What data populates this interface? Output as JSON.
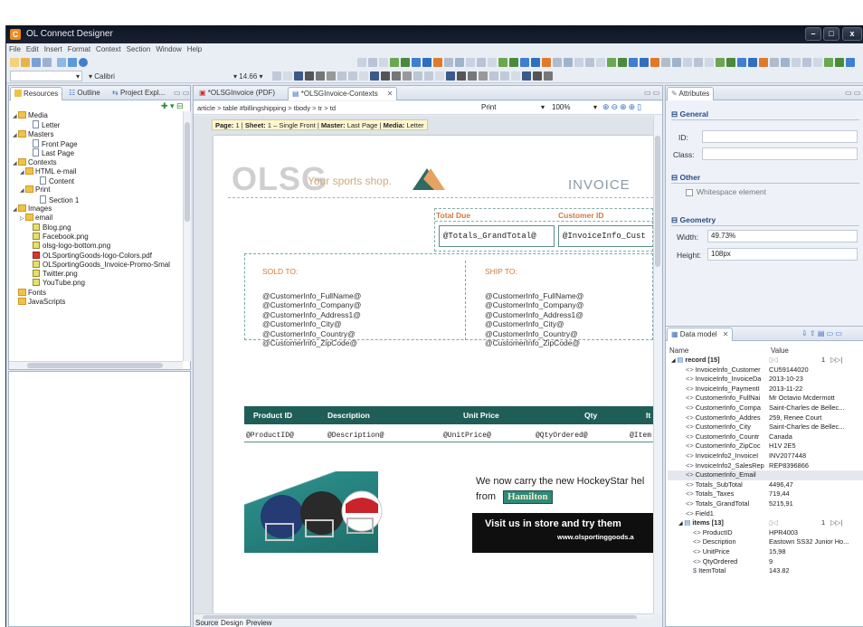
{
  "window": {
    "title": "OL Connect Designer",
    "icon": "C"
  },
  "menu": [
    "File",
    "Edit",
    "Insert",
    "Format",
    "Context",
    "Section",
    "Window",
    "Help"
  ],
  "font": {
    "name": "Calibri",
    "size": "14.66"
  },
  "left_tabs": [
    "Resources",
    "Outline",
    "Project Expl..."
  ],
  "tree": [
    {
      "label": "Media",
      "indent": 0,
      "icon": "folder",
      "tw": "◢"
    },
    {
      "label": "Letter",
      "indent": 2,
      "icon": "file",
      "tw": ""
    },
    {
      "label": "Masters",
      "indent": 0,
      "icon": "folder",
      "tw": "◢"
    },
    {
      "label": "Front Page",
      "indent": 2,
      "icon": "file",
      "tw": ""
    },
    {
      "label": "Last Page",
      "indent": 2,
      "icon": "file",
      "tw": ""
    },
    {
      "label": "Contexts",
      "indent": 0,
      "icon": "folder",
      "tw": "◢"
    },
    {
      "label": "HTML e-mail",
      "indent": 1,
      "icon": "folder",
      "tw": "◢"
    },
    {
      "label": "Content",
      "indent": 3,
      "icon": "file",
      "tw": ""
    },
    {
      "label": "Print",
      "indent": 1,
      "icon": "folder",
      "tw": "◢"
    },
    {
      "label": "Section 1",
      "indent": 3,
      "icon": "file",
      "tw": ""
    },
    {
      "label": "Images",
      "indent": 0,
      "icon": "folder",
      "tw": "◢"
    },
    {
      "label": "email",
      "indent": 1,
      "icon": "folder",
      "tw": "▷"
    },
    {
      "label": "Blog.png",
      "indent": 2,
      "icon": "img",
      "tw": ""
    },
    {
      "label": "Facebook.png",
      "indent": 2,
      "icon": "img",
      "tw": ""
    },
    {
      "label": "olsg-logo-bottom.png",
      "indent": 2,
      "icon": "img",
      "tw": ""
    },
    {
      "label": "OLSportingGoods-logo-Colors.pdf",
      "indent": 2,
      "icon": "pdf",
      "tw": ""
    },
    {
      "label": "OLSportingGoods_Invoice-Promo-Smal",
      "indent": 2,
      "icon": "img",
      "tw": ""
    },
    {
      "label": "Twitter.png",
      "indent": 2,
      "icon": "img",
      "tw": ""
    },
    {
      "label": "YouTube.png",
      "indent": 2,
      "icon": "img",
      "tw": ""
    },
    {
      "label": "Fonts",
      "indent": 0,
      "icon": "folder",
      "tw": ""
    },
    {
      "label": "JavaScripts",
      "indent": 0,
      "icon": "folder",
      "tw": ""
    }
  ],
  "editor_tabs": [
    "*OLSGInvoice (PDF)",
    "*OLSGInvoice-Contexts"
  ],
  "breadcrumb": "article > table #billingshipping > tbody > tr > td",
  "view_mode": "Print",
  "zoom": "100%",
  "pageinfo": {
    "page_k": "Page:",
    "page_v": "1",
    "sheet_k": "Sheet:",
    "sheet_v": "1 – Single Front",
    "master_k": "Master:",
    "master_v": "Last Page",
    "media_k": "Media:",
    "media_v": "Letter"
  },
  "doc": {
    "logo": "OLSG",
    "slogan": "Your sports shop.",
    "invoice": "INVOICE",
    "total_due": "Total Due",
    "customer_id": "Customer ID",
    "total_field": "@Totals_GrandTotal@",
    "cust_field": "@InvoiceInfo_Cust",
    "sold_to": "SOLD TO:",
    "ship_to": "SHIP TO:",
    "addr": [
      "@CustomerInfo_FullName@",
      "@CustomerInfo_Company@",
      "@CustomerInfo_Address1@",
      "@CustomerInfo_City@",
      "@CustomerInfo_Country@",
      "@CustomerInfo_ZipCode@"
    ],
    "headers": [
      "Product ID",
      "Description",
      "Unit Price",
      "Qty",
      "It"
    ],
    "row": [
      "@ProductID@",
      "@Description@",
      "@UnitPrice@",
      "@QtyOrdered@",
      "@Item"
    ],
    "promo1": "We now carry the new HockeyStar hel",
    "promo_from": "from",
    "promo_brand": "Hamilton",
    "promo2": "Visit us in store and try them",
    "promo3": "www.olsportinggoods.a"
  },
  "bottom_tabs": [
    "Source",
    "Design",
    "Preview"
  ],
  "attributes": {
    "tab": "Attributes",
    "general": "General",
    "id_label": "ID:",
    "class_label": "Class:",
    "other": "Other",
    "whitespace": "Whitespace element",
    "geometry": "Geometry",
    "width_label": "Width:",
    "width_value": "49.73%",
    "height_label": "Height:",
    "height_value": "108px"
  },
  "datamodel": {
    "tab": "Data model",
    "col_name": "Name",
    "col_value": "Value",
    "rows": [
      {
        "n": "record [15]",
        "v": "",
        "ind": 0,
        "kind": "record",
        "count": "1"
      },
      {
        "n": "InvoiceInfo_Customer",
        "v": "CU59144020",
        "ind": 2
      },
      {
        "n": "InvoiceInfo_InvoiceDa",
        "v": "2013-10-23",
        "ind": 2
      },
      {
        "n": "InvoiceInfo_PaymentI",
        "v": "2013-11-22",
        "ind": 2
      },
      {
        "n": "CustomerInfo_FullNai",
        "v": "Mr Octavio Mcdermott",
        "ind": 2
      },
      {
        "n": "CustomerInfo_Compa",
        "v": "Saint-Charles de Bellec...",
        "ind": 2
      },
      {
        "n": "CustomerInfo_Addres",
        "v": "259, Renee Court",
        "ind": 2
      },
      {
        "n": "CustomerInfo_City",
        "v": "Saint-Charles de Bellec...",
        "ind": 2
      },
      {
        "n": "CustomerInfo_Countr",
        "v": "Canada",
        "ind": 2
      },
      {
        "n": "CustomerInfo_ZipCoc",
        "v": "H1V 2E5",
        "ind": 2
      },
      {
        "n": "InvoiceInfo2_InvoiceI",
        "v": "INV2077448",
        "ind": 2
      },
      {
        "n": "InvoiceInfo2_SalesRep",
        "v": "REP8396866",
        "ind": 2
      },
      {
        "n": "CustomerInfo_Email",
        "v": "",
        "ind": 2
      },
      {
        "n": "Totals_SubTotal",
        "v": "4496,47",
        "ind": 2
      },
      {
        "n": "Totals_Taxes",
        "v": "719,44",
        "ind": 2
      },
      {
        "n": "Totals_GrandTotal",
        "v": "5215,91",
        "ind": 2
      },
      {
        "n": "Field1",
        "v": "",
        "ind": 2
      },
      {
        "n": "items [13]",
        "v": "",
        "ind": 1,
        "kind": "record",
        "count": "1"
      },
      {
        "n": "ProductID",
        "v": "HPR4003",
        "ind": 3
      },
      {
        "n": "Description",
        "v": "Eastown SS32 Junior Ho...",
        "ind": 3
      },
      {
        "n": "UnitPrice",
        "v": "15,98",
        "ind": 3
      },
      {
        "n": "QtyOrdered",
        "v": "9",
        "ind": 3
      },
      {
        "n": "ItemTotal",
        "v": "143.82",
        "ind": 3,
        "sym": "$"
      }
    ]
  },
  "colors": {
    "accent": "#1f5e57",
    "orange": "#e07a2a",
    "logo": "#c9c9c9",
    "hamilton": "#2e8a7a"
  }
}
